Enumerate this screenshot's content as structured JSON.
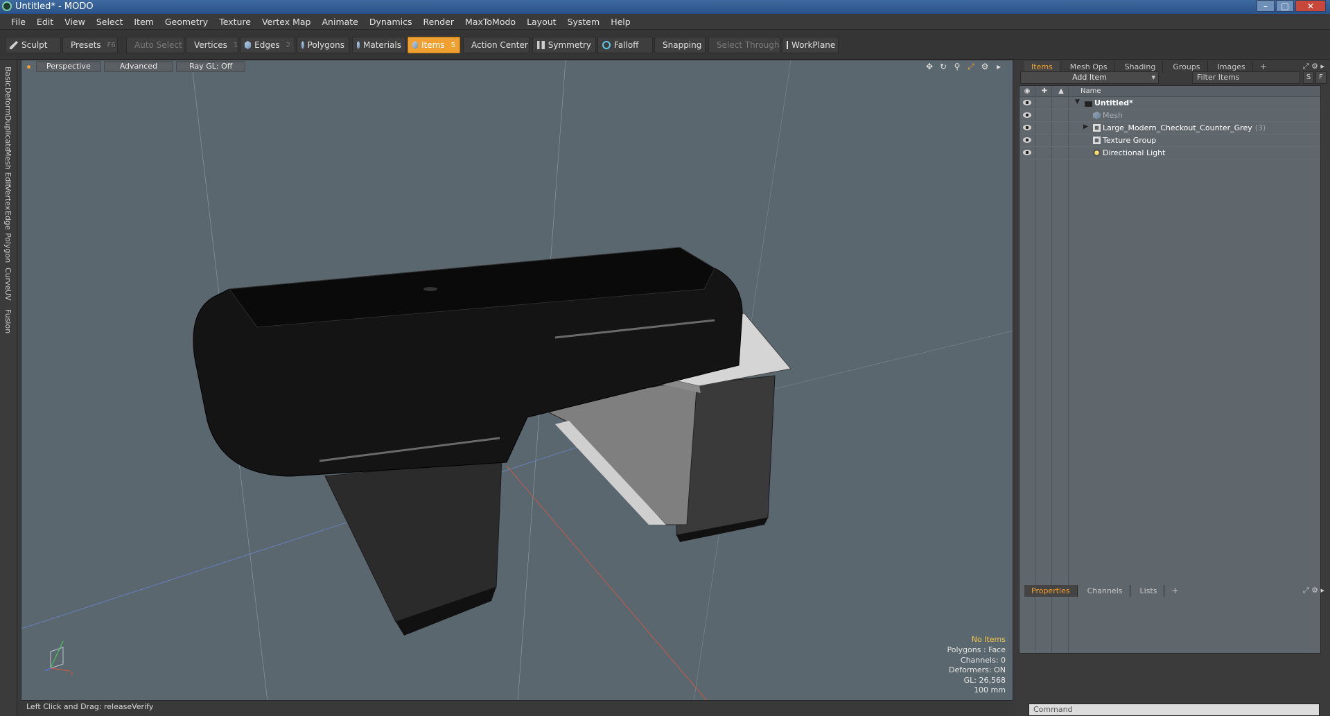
{
  "window": {
    "title": "Untitled* - MODO"
  },
  "menu": [
    "File",
    "Edit",
    "View",
    "Select",
    "Item",
    "Geometry",
    "Texture",
    "Vertex Map",
    "Animate",
    "Dynamics",
    "Render",
    "MaxToModo",
    "Layout",
    "System",
    "Help"
  ],
  "toolbar": {
    "sculpt": "Sculpt",
    "presets": "Presets",
    "presets_key": "F6",
    "auto_select": "Auto Select",
    "vertices": "Vertices",
    "vertices_key": "1",
    "edges": "Edges",
    "edges_key": "2",
    "polygons": "Polygons",
    "materials": "Materials",
    "items": "Items",
    "items_key": "5",
    "action_center": "Action Center",
    "symmetry": "Symmetry",
    "falloff": "Falloff",
    "snapping": "Snapping",
    "select_through": "Select Through",
    "workplane": "WorkPlane"
  },
  "left_tabs": [
    "Basic",
    "Deform",
    "Duplicate",
    "Mesh Edit",
    "Vertex",
    "Edge",
    "Polygon",
    "Curve",
    "UV",
    "Fusion"
  ],
  "viewport": {
    "view_mode": "Perspective",
    "shading": "Advanced",
    "raygl": "Ray GL: Off",
    "info": {
      "items": "No Items",
      "polygons": "Polygons : Face",
      "channels": "Channels: 0",
      "deformers": "Deformers: ON",
      "gl": "GL: 26,568",
      "grid": "100 mm"
    }
  },
  "status": {
    "text": "Left Click and Drag:   releaseVerify"
  },
  "items_panel": {
    "tabs": [
      "Items",
      "Mesh Ops",
      "Shading",
      "Groups",
      "Images"
    ],
    "add_item": "Add Item",
    "filter_placeholder": "Filter Items",
    "btn_s": "S",
    "btn_f": "F",
    "col_name": "Name",
    "tree": [
      {
        "label": "Untitled*",
        "level": 0
      },
      {
        "label": "Mesh",
        "level": 1
      },
      {
        "label": "Large_Modern_Checkout_Counter_Grey",
        "count": "(3)",
        "level": 1
      },
      {
        "label": "Texture Group",
        "level": 1
      },
      {
        "label": "Directional Light",
        "level": 1
      }
    ]
  },
  "props_panel": {
    "tabs": [
      "Properties",
      "Channels",
      "Lists"
    ],
    "command_placeholder": "Command"
  },
  "colors": {
    "accent": "#f0a030",
    "viewport_bg": "#5b676e",
    "tree_bg": "#5f666c"
  }
}
